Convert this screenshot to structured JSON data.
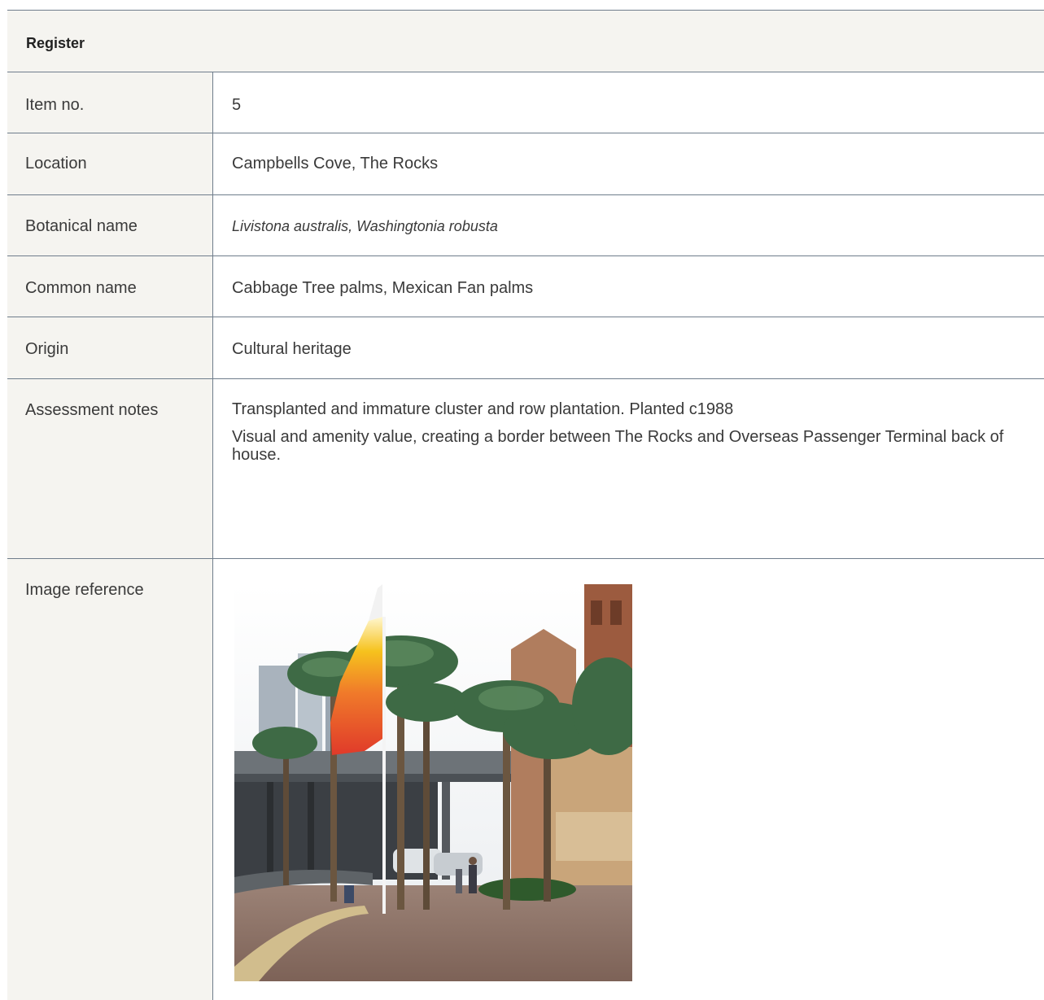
{
  "register": {
    "heading": "Register",
    "rows": {
      "item_no": {
        "label": "Item no.",
        "value": "5"
      },
      "location": {
        "label": "Location",
        "value": "Campbells Cove, The Rocks"
      },
      "botanical_name": {
        "label": "Botanical name",
        "value": "Livistona australis, Washingtonia robusta"
      },
      "common_name": {
        "label": "Common name",
        "value": "Cabbage Tree palms, Mexican Fan palms"
      },
      "origin": {
        "label": "Origin",
        "value": "Cultural heritage"
      },
      "assessment_notes": {
        "label": "Assessment notes",
        "lines": [
          "Transplanted and immature cluster and row plantation. Planted c1988",
          "Visual and amenity value, creating a border between The Rocks and Overseas Passenger Terminal back of house."
        ]
      },
      "image_reference": {
        "label": "Image reference"
      }
    }
  },
  "colors": {
    "label_bg": "#f5f4f0",
    "rule": "#6f7d8c",
    "text": "#3a3a3a"
  }
}
